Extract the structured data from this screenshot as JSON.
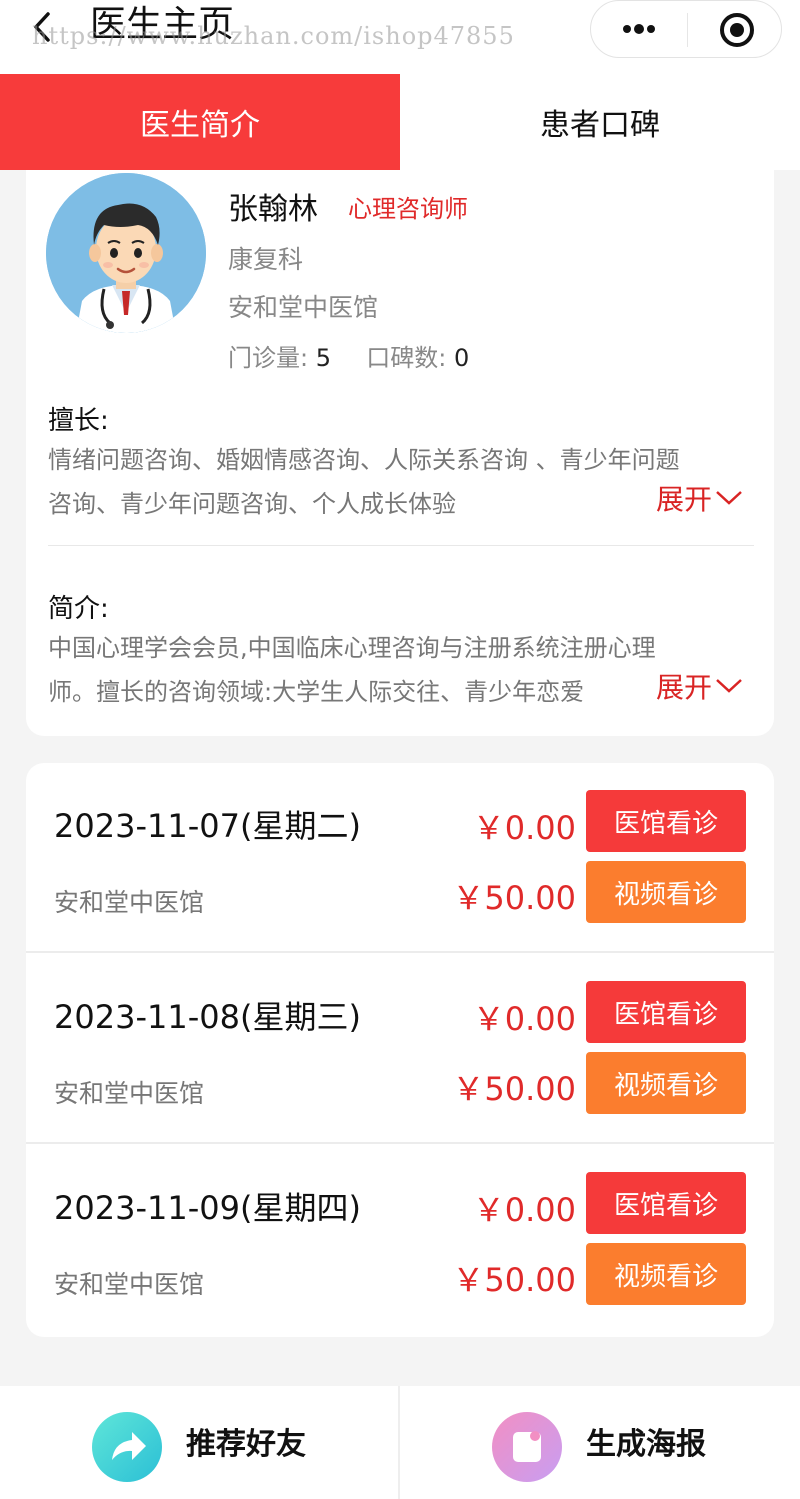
{
  "nav": {
    "title": "医生主页",
    "watermark": "https://www.huzhan.com/ishop47855"
  },
  "tabs": [
    {
      "label": "医生简介",
      "active": true
    },
    {
      "label": "患者口碑",
      "active": false
    }
  ],
  "doctor": {
    "name": "张翰林",
    "title": "心理咨询师",
    "department": "康复科",
    "hospital": "安和堂中医馆",
    "visits_label": "门诊量:",
    "visits": "5",
    "reviews_label": "口碑数:",
    "reviews": "0"
  },
  "specialty": {
    "label": "擅长:",
    "line1": "情绪问题咨询、婚姻情感咨询、人际关系咨询 、青少年问题",
    "line2": "咨询、青少年问题咨询、个人成长体验",
    "expand": "展开"
  },
  "intro": {
    "label": "简介:",
    "line1": "中国心理学会会员,中国临床心理咨询与注册系统注册心理",
    "line2": "师。擅长的咨询领域:大学生人际交往、青少年恋爱",
    "expand": "展开"
  },
  "schedule": [
    {
      "date": "2023-11-07(星期二)",
      "hospital": "安和堂中医馆",
      "clinic_price": "￥0.00",
      "clinic_btn": "医馆看诊",
      "video_price": "￥50.00",
      "video_btn": "视频看诊"
    },
    {
      "date": "2023-11-08(星期三)",
      "hospital": "安和堂中医馆",
      "clinic_price": "￥0.00",
      "clinic_btn": "医馆看诊",
      "video_price": "￥50.00",
      "video_btn": "视频看诊"
    },
    {
      "date": "2023-11-09(星期四)",
      "hospital": "安和堂中医馆",
      "clinic_price": "￥0.00",
      "clinic_btn": "医馆看诊",
      "video_price": "￥50.00",
      "video_btn": "视频看诊"
    }
  ],
  "bottom": {
    "share_label": "推荐好友",
    "poster_label": "生成海报"
  },
  "colors": {
    "primary": "#f73b3b",
    "orange": "#fb7d2e",
    "price": "#e02a2a"
  },
  "icons": [
    "back-icon",
    "more-icon",
    "target-icon",
    "share-icon",
    "poster-icon",
    "chevron-down-icon"
  ]
}
